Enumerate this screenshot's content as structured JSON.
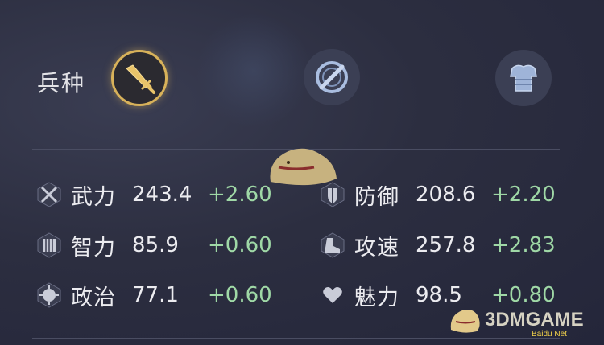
{
  "troops": {
    "label": "兵种",
    "icons": [
      {
        "icon": "sword-icon",
        "active": true
      },
      {
        "icon": "shield-sword-icon",
        "active": false
      },
      {
        "icon": "armor-icon",
        "active": false
      }
    ]
  },
  "stats": [
    {
      "icon": "crossed-swords-icon",
      "name": "武力",
      "value": "243.4",
      "bonus": "+2.60"
    },
    {
      "icon": "defense-shield-icon",
      "name": "防御",
      "value": "208.6",
      "bonus": "+2.20"
    },
    {
      "icon": "book-icon",
      "name": "智力",
      "value": "85.9",
      "bonus": "+0.60"
    },
    {
      "icon": "boot-icon",
      "name": "攻速",
      "value": "257.8",
      "bonus": "+2.83"
    },
    {
      "icon": "politics-icon",
      "name": "政治",
      "value": "77.1",
      "bonus": "+0.60"
    },
    {
      "icon": "heart-icon",
      "name": "魅力",
      "value": "98.5",
      "bonus": "+0.80"
    }
  ],
  "watermark": {
    "text": "3DMGAME",
    "sub": "Baidu Net"
  },
  "colors": {
    "gold": "#d8b25a",
    "bonus_green": "#9fd8a6",
    "icon_blue": "#a9bde0"
  }
}
